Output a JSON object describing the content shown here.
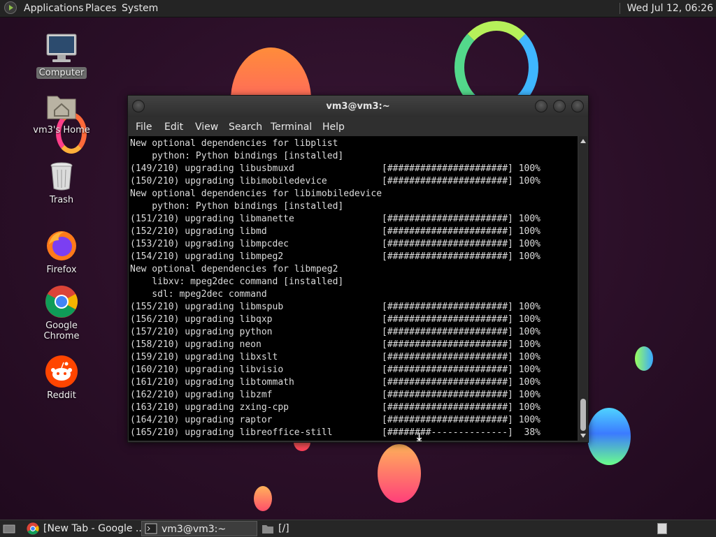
{
  "top_panel": {
    "menus": [
      "Applications",
      "Places",
      "System"
    ],
    "clock": "Wed Jul 12, 06:26"
  },
  "desktop": {
    "icons": [
      {
        "label": "Computer",
        "icon": "computer-icon"
      },
      {
        "label": "vm3's Home",
        "icon": "home-folder-icon"
      },
      {
        "label": "Trash",
        "icon": "trash-icon"
      },
      {
        "label": "Firefox",
        "icon": "firefox-icon"
      },
      {
        "label": "Google Chrome",
        "icon": "chrome-icon"
      },
      {
        "label": "Reddit",
        "icon": "reddit-icon"
      }
    ]
  },
  "terminal": {
    "title": "vm3@vm3:~",
    "menus": [
      "File",
      "Edit",
      "View",
      "Search",
      "Terminal",
      "Help"
    ],
    "lines": [
      "New optional dependencies for libplist",
      "    python: Python bindings [installed]",
      "(149/210) upgrading libusbmuxd                [######################] 100%",
      "(150/210) upgrading libimobiledevice          [######################] 100%",
      "New optional dependencies for libimobiledevice",
      "    python: Python bindings [installed]",
      "(151/210) upgrading libmanette                [######################] 100%",
      "(152/210) upgrading libmd                     [######################] 100%",
      "(153/210) upgrading libmpcdec                 [######################] 100%",
      "(154/210) upgrading libmpeg2                  [######################] 100%",
      "New optional dependencies for libmpeg2",
      "    libxv: mpeg2dec command [installed]",
      "    sdl: mpeg2dec command",
      "(155/210) upgrading libmspub                  [######################] 100%",
      "(156/210) upgrading libqxp                    [######################] 100%",
      "(157/210) upgrading python                    [######################] 100%",
      "(158/210) upgrading neon                      [######################] 100%",
      "(159/210) upgrading libxslt                   [######################] 100%",
      "(160/210) upgrading libvisio                  [######################] 100%",
      "(161/210) upgrading libtommath                [######################] 100%",
      "(162/210) upgrading libzmf                    [######################] 100%",
      "(163/210) upgrading zxing-cpp                 [######################] 100%",
      "(164/210) upgrading raptor                    [######################] 100%",
      "(165/210) upgrading libreoffice-still         [########--------------]  38%"
    ]
  },
  "taskbar": {
    "items": [
      {
        "label": "[New Tab - Google ...",
        "icon": "chrome-icon",
        "active": false
      },
      {
        "label": "vm3@vm3:~",
        "icon": "terminal-icon",
        "active": true
      },
      {
        "label": "[/]",
        "icon": "folder-icon",
        "active": false
      }
    ]
  }
}
